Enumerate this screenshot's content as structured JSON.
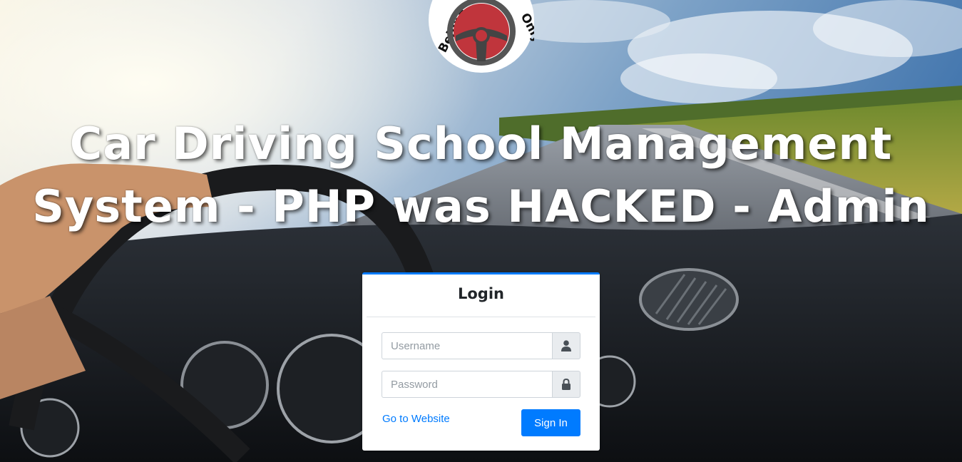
{
  "logo": {
    "text": "Behind the Wheel Only",
    "visible_text_left": "Behind",
    "visible_text_right": "Only",
    "color_wheel": "#c0353c",
    "color_rim": "#555555"
  },
  "header": {
    "title": "Car Driving School Management System - PHP was HACKED - Admin"
  },
  "login": {
    "title": "Login",
    "username_placeholder": "Username",
    "username_value": "",
    "password_placeholder": "Password",
    "password_value": "",
    "username_icon": "user-icon",
    "password_icon": "lock-icon",
    "website_link": "Go to Website",
    "signin_label": "Sign In",
    "accent": "#007bff"
  }
}
